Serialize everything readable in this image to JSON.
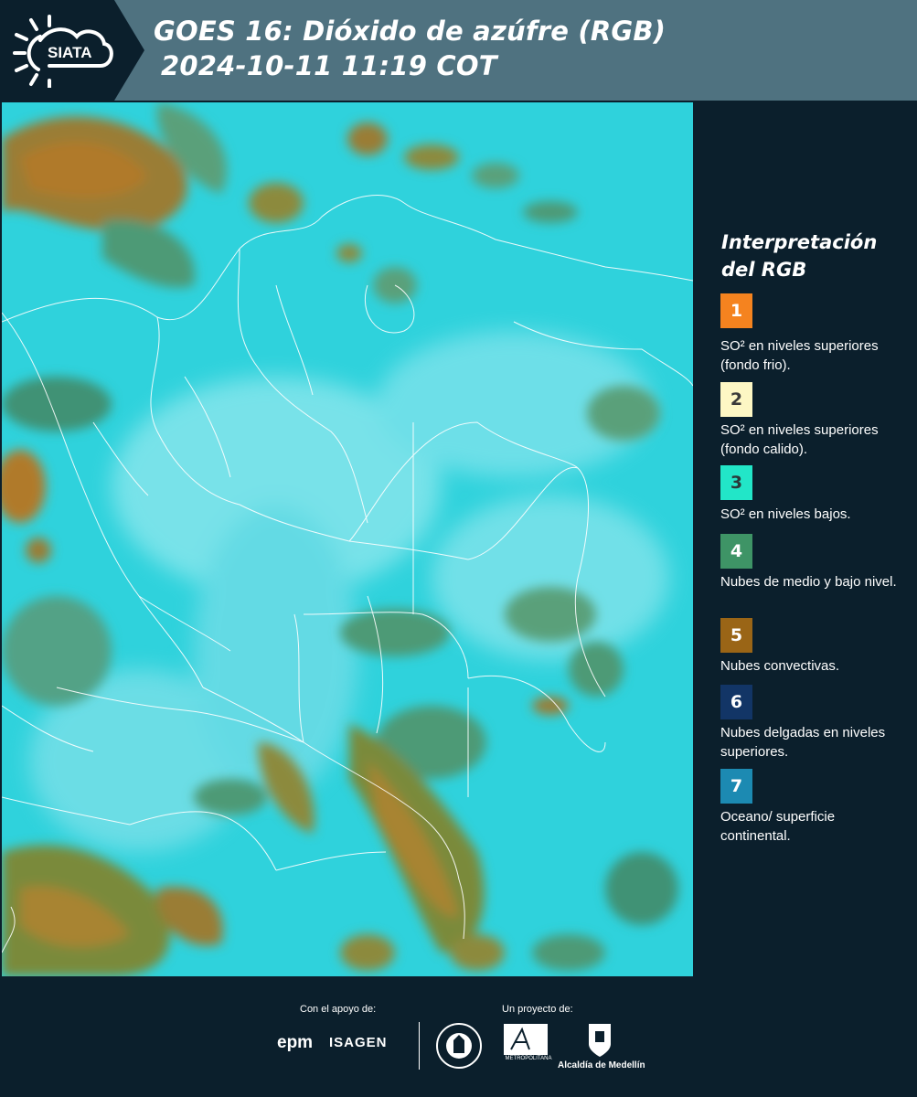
{
  "header": {
    "brand": "SIATA",
    "title_line1": "GOES 16: Dióxido de azúfre (RGB)",
    "title_line2": "2024-10-11 11:19 COT"
  },
  "map": {
    "background_color": "#2fd2dc",
    "cloud_colors": [
      "#2f9c7c",
      "#8c8a3c",
      "#b07a2a",
      "#a0e8f0"
    ]
  },
  "legend": {
    "title": "Interpretación del RGB",
    "items": [
      {
        "number": "1",
        "color": "#f5831f",
        "number_color": "#ffffff",
        "text": "SO² en niveles superiores (fondo frio)."
      },
      {
        "number": "2",
        "color": "#fdf7c4",
        "number_color": "#3a3a3a",
        "text": "SO² en niveles superiores (fondo calido)."
      },
      {
        "number": "3",
        "color": "#22e6c8",
        "number_color": "#2a3a3a",
        "text": "SO² en niveles bajos."
      },
      {
        "number": "4",
        "color": "#3e9466",
        "number_color": "#ffffff",
        "text": "Nubes de medio y bajo nivel."
      },
      {
        "number": "5",
        "color": "#9a6516",
        "number_color": "#ffffff",
        "text": "Nubes convectivas."
      },
      {
        "number": "6",
        "color": "#123566",
        "number_color": "#ffffff",
        "text": "Nubes delgadas en niveles superiores."
      },
      {
        "number": "7",
        "color": "#1c8ab2",
        "number_color": "#ffffff",
        "text": "Oceano/ superficie continental."
      }
    ]
  },
  "footer": {
    "support_label": "Con el apoyo de:",
    "project_label": "Un proyecto de:",
    "sponsor_1": "epm",
    "sponsor_2": "ISAGEN",
    "partner_1": "METROPOLITANA",
    "partner_2": "Alcaldía de Medellín"
  }
}
